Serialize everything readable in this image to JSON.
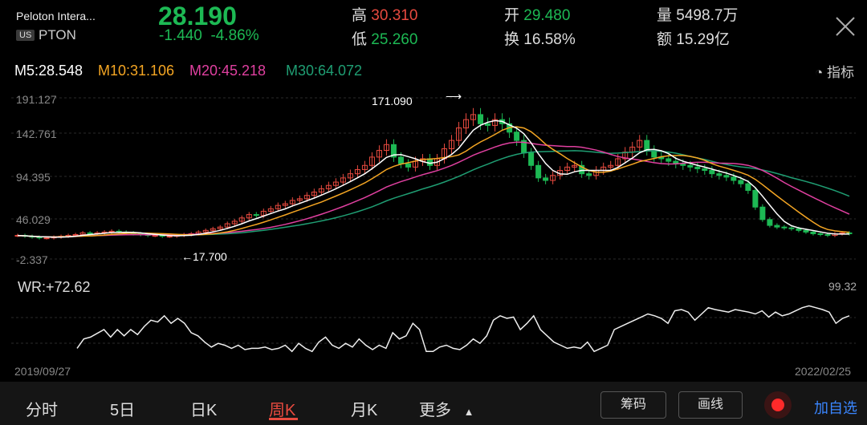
{
  "header": {
    "name": "Peloton Intera...",
    "market": "US",
    "ticker": "PTON",
    "price": "28.190",
    "change": "-1.440",
    "change_pct": "-4.86%",
    "high_label": "高",
    "high": "30.310",
    "low_label": "低",
    "low": "25.260",
    "open_label": "开",
    "open": "29.480",
    "turnover_label": "换",
    "turnover": "16.58%",
    "volume_label": "量",
    "volume": "5498.7万",
    "amount_label": "额",
    "amount": "15.29亿"
  },
  "ma": {
    "m5": "M5:28.548",
    "m10": "M10:31.106",
    "m20": "M20:45.218",
    "m30": "M30:64.072"
  },
  "indicator_label": "指标",
  "axis": {
    "y1": "191.127",
    "y2": "142.761",
    "y3": "94.395",
    "y4": "46.029",
    "y5": "-2.337",
    "max_annot": "171.090",
    "min_annot": "17.700"
  },
  "wr": {
    "label": "WR:+72.62",
    "max": "99.32"
  },
  "dates": {
    "start": "2019/09/27",
    "end": "2022/02/25"
  },
  "tabs": {
    "t1": "分时",
    "t2": "5日",
    "t3": "日K",
    "t4": "周K",
    "t5": "月K",
    "t6": "更多"
  },
  "buttons": {
    "chip": "筹码",
    "draw": "画线",
    "add": "加自选"
  },
  "colors": {
    "up": "#e84a3f",
    "down": "#1db954",
    "m5": "#ffffff",
    "m10": "#f5a623",
    "m20": "#e040a0",
    "m30": "#1f9e73"
  },
  "chart_data": {
    "type": "candlestick",
    "ylim": [
      -2.337,
      191.127
    ],
    "yticks": [
      191.127,
      142.761,
      94.395,
      46.029,
      -2.337
    ],
    "close": [
      26,
      25,
      24,
      23,
      23,
      24,
      25,
      26,
      27,
      29,
      28,
      29,
      30,
      31,
      30,
      29,
      28,
      27,
      26,
      26,
      25,
      25,
      26,
      27,
      28,
      30,
      32,
      34,
      36,
      40,
      43,
      47,
      51,
      50,
      55,
      58,
      62,
      64,
      68,
      70,
      74,
      78,
      82,
      86,
      90,
      95,
      100,
      105,
      110,
      120,
      128,
      135,
      120,
      112,
      108,
      115,
      118,
      110,
      118,
      130,
      140,
      155,
      165,
      171,
      160,
      158,
      165,
      160,
      150,
      140,
      125,
      110,
      95,
      92,
      98,
      104,
      108,
      110,
      100,
      98,
      104,
      108,
      110,
      118,
      126,
      132,
      140,
      128,
      120,
      118,
      115,
      112,
      110,
      108,
      106,
      104,
      100,
      98,
      96,
      92,
      88,
      80,
      60,
      45,
      38,
      36,
      35,
      34,
      32,
      30,
      28,
      27,
      26,
      28,
      29,
      28
    ]
  },
  "wr_data": [
    20,
    35,
    38,
    44,
    50,
    38,
    50,
    40,
    50,
    42,
    55,
    65,
    62,
    72,
    60,
    68,
    60,
    45,
    40,
    30,
    22,
    28,
    25,
    20,
    25,
    18,
    20,
    20,
    22,
    18,
    20,
    25,
    15,
    28,
    20,
    15,
    30,
    38,
    25,
    20,
    28,
    22,
    35,
    25,
    18,
    25,
    20,
    45,
    35,
    40,
    60,
    50,
    15,
    15,
    22,
    25,
    20,
    18,
    25,
    35,
    28,
    40,
    65,
    72,
    68,
    70,
    50,
    60,
    72,
    50,
    40,
    30,
    25,
    20,
    22,
    20,
    30,
    15,
    20,
    25,
    50,
    55,
    60,
    65,
    70,
    75,
    72,
    68,
    60,
    80,
    82,
    78,
    65,
    75,
    85,
    82,
    80,
    78,
    82,
    80,
    78,
    75,
    80,
    70,
    78,
    72,
    75,
    80,
    85,
    88,
    85,
    82,
    78,
    60,
    68,
    72
  ]
}
